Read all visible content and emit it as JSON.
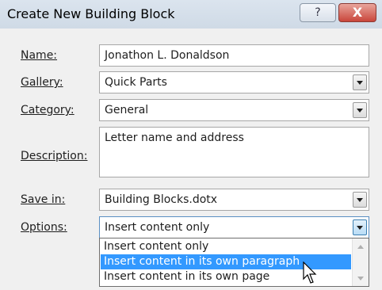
{
  "dialog": {
    "title": "Create New Building Block",
    "help_icon": "?",
    "close_icon": "X"
  },
  "form": {
    "name": {
      "label": "Name:",
      "value": "Jonathon L. Donaldson"
    },
    "gallery": {
      "label": "Gallery:",
      "value": "Quick Parts"
    },
    "category": {
      "label": "Category:",
      "value": "General"
    },
    "description": {
      "label": "Description:",
      "value": "Letter name and address"
    },
    "save_in": {
      "label": "Save in:",
      "value": "Building Blocks.dotx"
    },
    "options": {
      "label": "Options:",
      "value": "Insert content only",
      "list": [
        "Insert content only",
        "Insert content in its own paragraph",
        "Insert content in its own page"
      ],
      "highlighted_index": 1
    }
  },
  "colors": {
    "selection": "#3399ff",
    "close_button": "#c9463b"
  }
}
